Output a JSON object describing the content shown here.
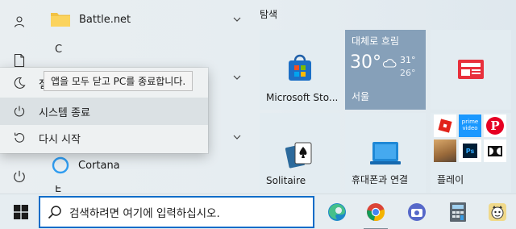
{
  "app_list": {
    "items": [
      {
        "label": "Battle.net",
        "type": "folder"
      },
      {
        "label": "C",
        "type": "letter"
      },
      {
        "label": "Cortana",
        "type": "app"
      },
      {
        "label": "E",
        "type": "letter"
      }
    ]
  },
  "power_menu": {
    "items": [
      {
        "label": "절전",
        "icon": "moon-icon"
      },
      {
        "label": "시스템 종료",
        "icon": "power-icon"
      },
      {
        "label": "다시 시작",
        "icon": "restart-icon"
      }
    ],
    "tooltip": "앱을 모두 닫고 PC를 종료합니다."
  },
  "tiles": {
    "header": "탐색",
    "store": {
      "label": "Microsoft Sto..."
    },
    "weather": {
      "condition": "대체로 흐림",
      "temp": "30°",
      "high": "31°",
      "low": "26°",
      "city": "서울"
    },
    "news": {
      "label": ""
    },
    "solitaire": {
      "label": "Solitaire"
    },
    "phone": {
      "label": "휴대폰과 연결"
    },
    "play": {
      "label": "플레이",
      "apps": [
        "roblox-icon",
        "prime-video-icon",
        "pinterest-icon",
        "game-icon",
        "photoshop-icon",
        "dolby-icon"
      ],
      "prime_text": "prime video"
    }
  },
  "taskbar": {
    "search_placeholder": "검색하려면 여기에 입력하십시오.",
    "apps": [
      "edge-icon",
      "chrome-icon",
      "camera-icon",
      "calculator-icon",
      "pet-app-icon"
    ]
  },
  "colors": {
    "accent_blue": "#0a6cc8",
    "start_bg": "#e6edf1",
    "weather_tile": "#86a0b9",
    "news_red": "#e8303c"
  }
}
